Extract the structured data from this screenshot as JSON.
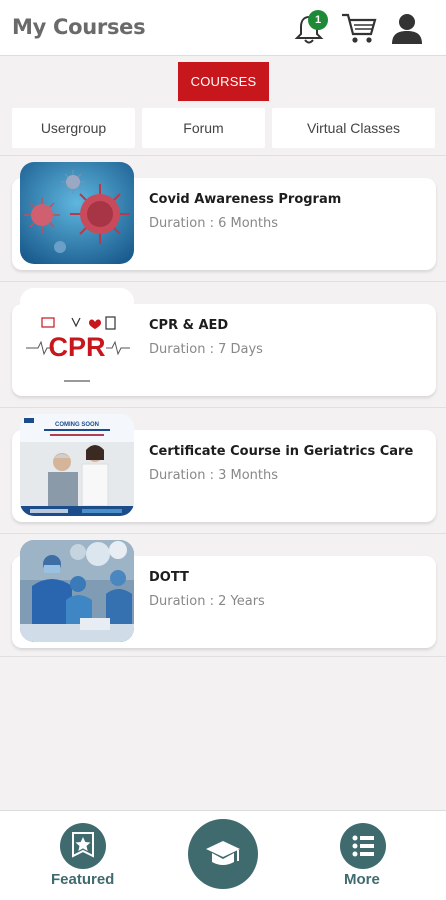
{
  "header": {
    "title": "My Courses",
    "notification_count": "1"
  },
  "tabs": {
    "active": "COURSES",
    "sub": [
      "Usergroup",
      "Forum",
      "Virtual Classes"
    ]
  },
  "courses": [
    {
      "name": "Covid Awareness Program",
      "duration": "Duration : 6 Months",
      "thumb": "virus-image"
    },
    {
      "name": "CPR & AED",
      "duration": "Duration : 7 Days",
      "thumb": "cpr-image"
    },
    {
      "name": "Certificate Course in Geriatrics Care",
      "duration": "Duration : 3 Months",
      "thumb": "geriatrics-image"
    },
    {
      "name": "DOTT",
      "duration": "Duration : 2 Years",
      "thumb": "surgery-image"
    }
  ],
  "cpr_thumb_text": "CPR",
  "geriatrics_thumb_text": "COMING SOON",
  "bottom_nav": {
    "featured": "Featured",
    "more": "More"
  },
  "colors": {
    "accent_red": "#c8161d",
    "nav_teal": "#3f6b6f",
    "badge_green": "#1e8a38"
  }
}
